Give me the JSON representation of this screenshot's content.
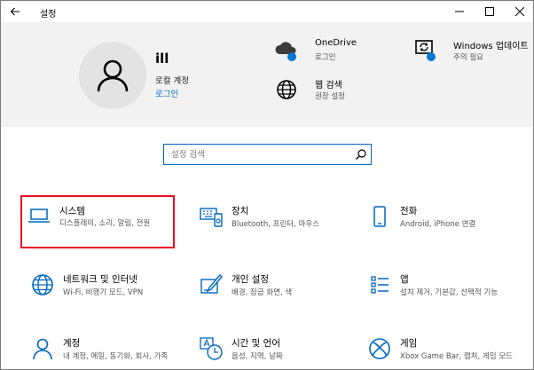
{
  "window": {
    "title": "설정"
  },
  "user": {
    "name": "ill",
    "account_type": "로컬 계정",
    "login_link": "로그인"
  },
  "header_items": {
    "onedrive": {
      "title": "OneDrive",
      "sub": "로그인"
    },
    "windows_update": {
      "title": "Windows 업데이트",
      "sub": "주의 필요"
    },
    "web_search": {
      "title": "웹 검색",
      "sub": "권장 설정"
    }
  },
  "search": {
    "placeholder": "설정 검색"
  },
  "tiles": [
    {
      "title": "시스템",
      "desc": "디스플레이, 소리, 알림, 전원",
      "icon": "laptop-icon"
    },
    {
      "title": "장치",
      "desc": "Bluetooth, 프린터, 마우스",
      "icon": "devices-icon"
    },
    {
      "title": "전화",
      "desc": "Android, iPhone 연결",
      "icon": "phone-icon"
    },
    {
      "title": "네트워크 및 인터넷",
      "desc": "Wi-Fi, 비행기 모드, VPN",
      "icon": "globe-icon"
    },
    {
      "title": "개인 설정",
      "desc": "배경, 잠금 화면, 색",
      "icon": "personalization-icon"
    },
    {
      "title": "앱",
      "desc": "설치 제거, 기본값, 선택적 기능",
      "icon": "apps-icon"
    },
    {
      "title": "계정",
      "desc": "내 계정, 메일, 동기화, 회사, 가족",
      "icon": "account-icon"
    },
    {
      "title": "시간 및 언어",
      "desc": "음성, 지역, 날짜",
      "icon": "time-language-icon"
    },
    {
      "title": "게임",
      "desc": "Xbox Game Bar, 캡처, 게임 모드",
      "icon": "xbox-icon"
    }
  ],
  "colors": {
    "accent": "#0067c0",
    "selection_outline": "#e81123",
    "header_bg": "#f2f2f2"
  }
}
